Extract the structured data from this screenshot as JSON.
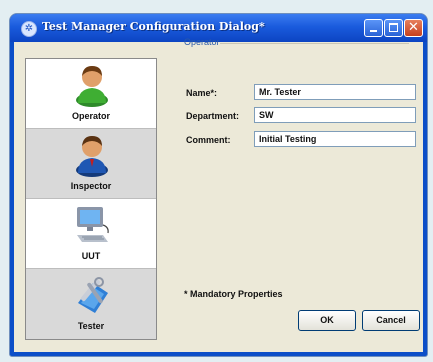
{
  "window": {
    "title": "Test Manager Configuration Dialog*",
    "title_icon": "gear-icon"
  },
  "sidebar": {
    "items": [
      {
        "label": "Operator",
        "icon": "operator-person-icon",
        "selected": true
      },
      {
        "label": "Inspector",
        "icon": "inspector-person-icon",
        "selected": false
      },
      {
        "label": "UUT",
        "icon": "computer-icon",
        "selected": false
      },
      {
        "label": "Tester",
        "icon": "tester-tools-icon",
        "selected": false
      }
    ]
  },
  "form": {
    "group_title": "Operator",
    "fields": [
      {
        "label": "Name*:",
        "value": "Mr. Tester"
      },
      {
        "label": "Department:",
        "value": "SW"
      },
      {
        "label": "Comment:",
        "value": "Initial Testing"
      }
    ],
    "mandatory_note": "* Mandatory Properties"
  },
  "buttons": {
    "ok": "OK",
    "cancel": "Cancel"
  },
  "colors": {
    "titlebar": "#0c44c2",
    "client": "#ece9d8",
    "group_title": "#2b5aa8"
  }
}
